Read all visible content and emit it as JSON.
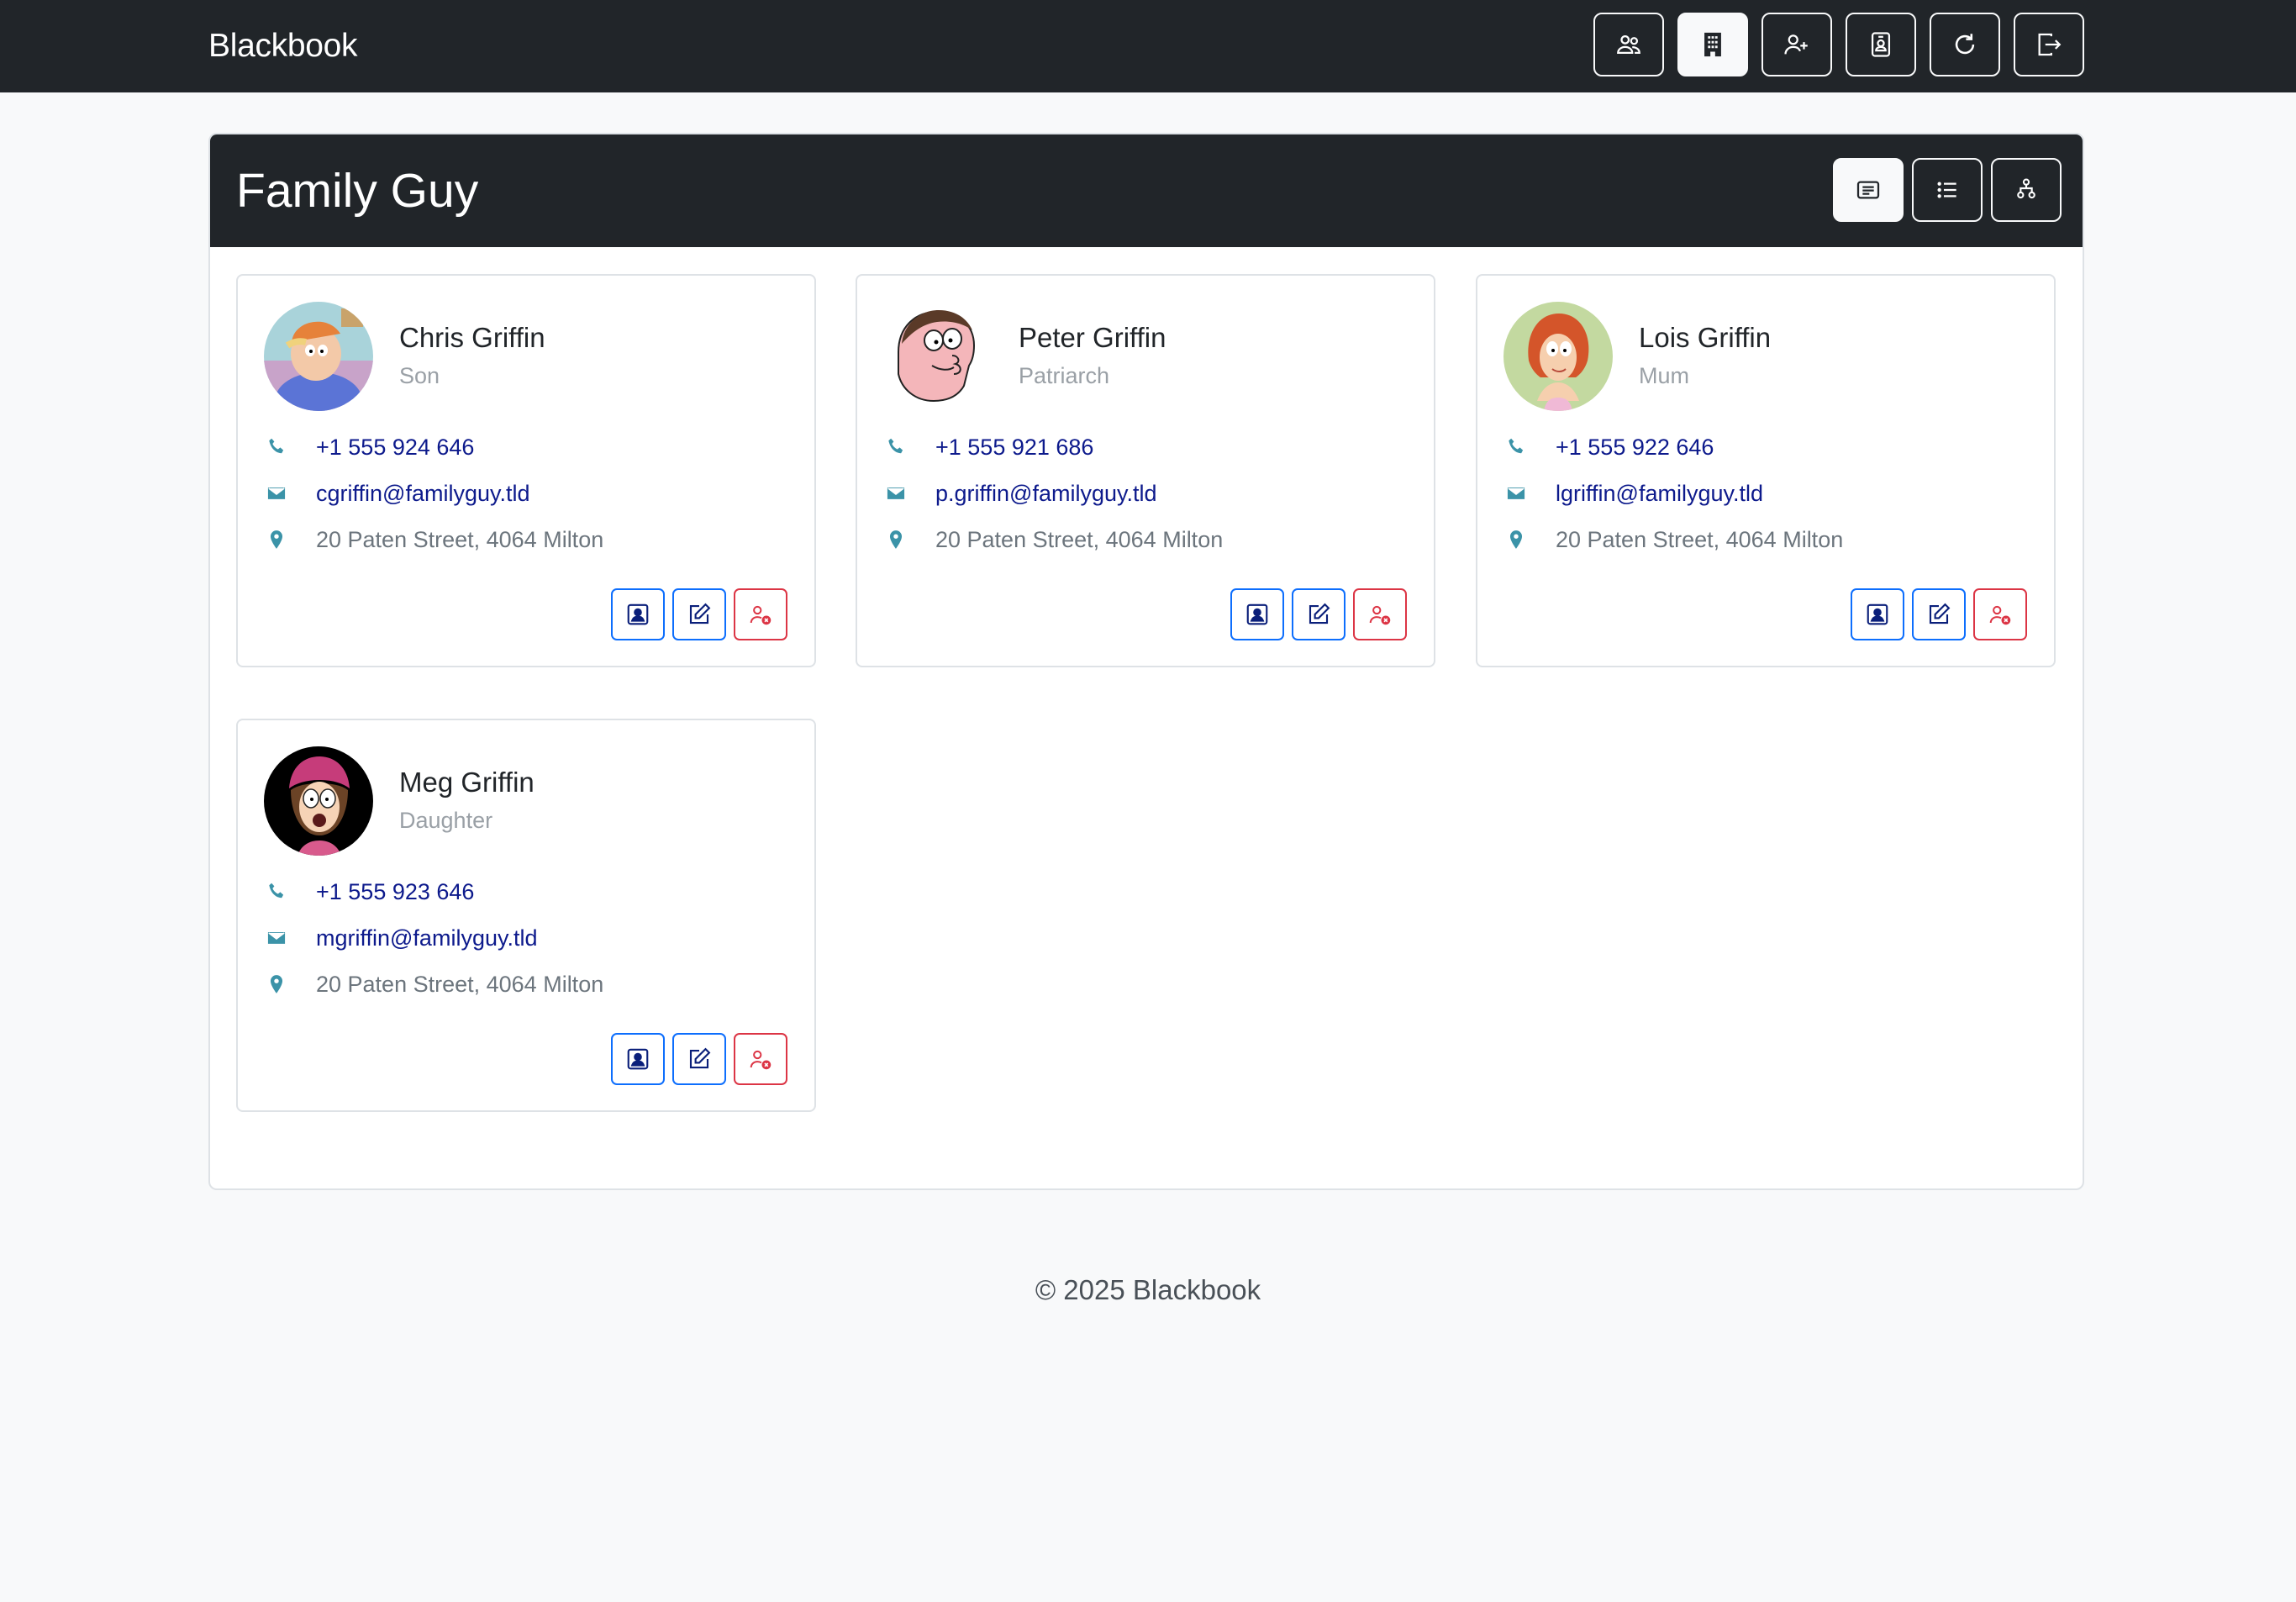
{
  "app": {
    "brand": "Blackbook"
  },
  "nav": {
    "buttons": [
      {
        "icon": "people-icon",
        "active": false
      },
      {
        "icon": "building-icon",
        "active": true
      },
      {
        "icon": "person-add-icon",
        "active": false
      },
      {
        "icon": "person-badge-icon",
        "active": false
      },
      {
        "icon": "refresh-icon",
        "active": false
      },
      {
        "icon": "logout-icon",
        "active": false
      }
    ]
  },
  "group": {
    "title": "Family Guy",
    "view_buttons": [
      {
        "icon": "card-view-icon",
        "active": true
      },
      {
        "icon": "list-view-icon",
        "active": false
      },
      {
        "icon": "hierarchy-view-icon",
        "active": false
      }
    ]
  },
  "contacts": [
    {
      "name": "Chris Griffin",
      "role": "Son",
      "phone": "+1 555 924 646",
      "email": "cgriffin@familyguy.tld",
      "address": "20 Paten Street, 4064 Milton"
    },
    {
      "name": "Peter Griffin",
      "role": "Patriarch",
      "phone": "+1 555 921 686",
      "email": "p.griffin@familyguy.tld",
      "address": "20 Paten Street, 4064 Milton"
    },
    {
      "name": "Lois Griffin",
      "role": "Mum",
      "phone": "+1 555 922 646",
      "email": "lgriffin@familyguy.tld",
      "address": "20 Paten Street, 4064 Milton"
    },
    {
      "name": "Meg Griffin",
      "role": "Daughter",
      "phone": "+1 555 923 646",
      "email": "mgriffin@familyguy.tld",
      "address": "20 Paten Street, 4064 Milton"
    }
  ],
  "footer": {
    "text": "© 2025 Blackbook"
  },
  "colors": {
    "navbar": "#212529",
    "accent_icon": "#3b93a8",
    "link": "#0d1a8c",
    "primary": "#0d6efd",
    "danger": "#dc3545"
  }
}
